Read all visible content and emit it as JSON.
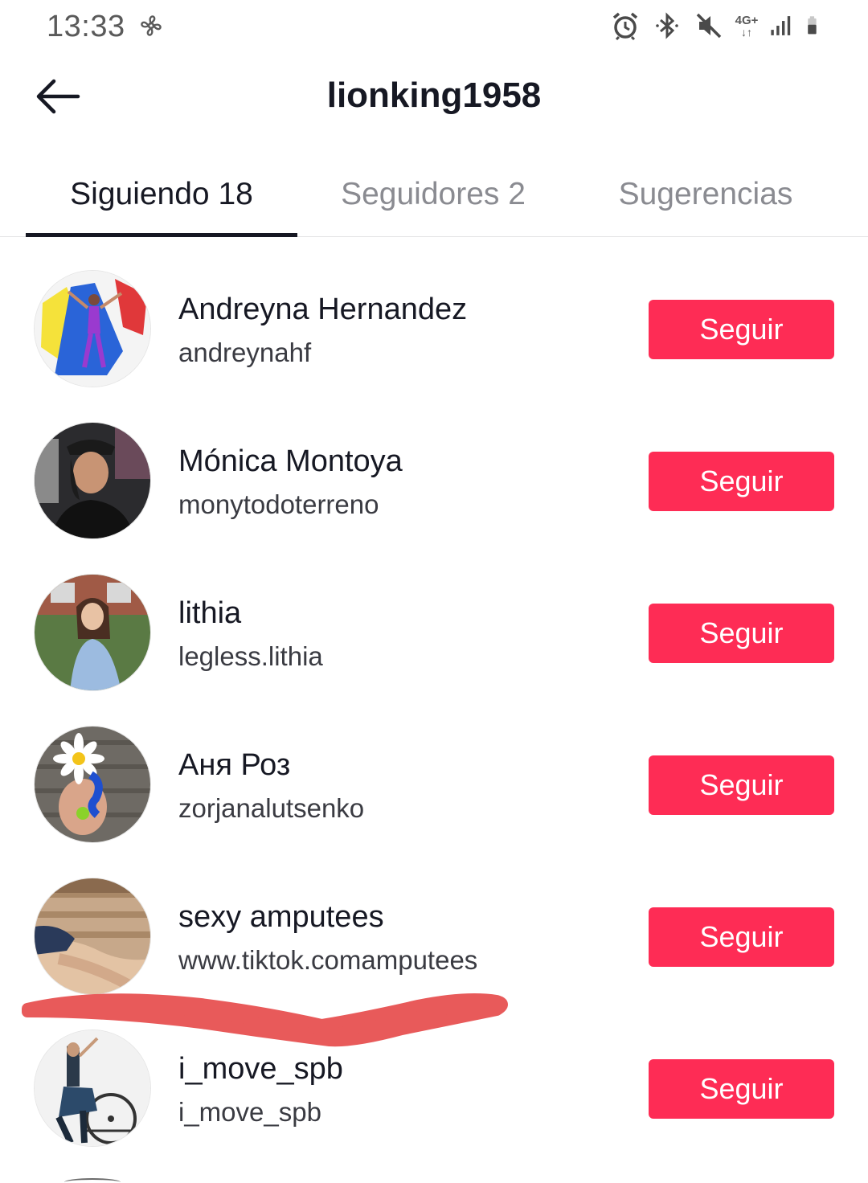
{
  "status_bar": {
    "time": "13:33",
    "left_icon": "fan-icon",
    "icons": [
      "alarm-icon",
      "bluetooth-icon",
      "mute-icon",
      "network-4g-icon",
      "signal-icon",
      "battery-icon"
    ],
    "network_label": "4G+"
  },
  "header": {
    "title": "lionking1958",
    "back_icon": "arrow-left-icon"
  },
  "tabs": [
    {
      "label": "Siguiendo 18",
      "active": true
    },
    {
      "label": "Seguidores 2",
      "active": false
    },
    {
      "label": "Sugerencias",
      "active": false
    }
  ],
  "users": [
    {
      "name": "Andreyna Hernandez",
      "handle": "andreynahf",
      "button": "Seguir"
    },
    {
      "name": "Mónica Montoya",
      "handle": "monytodoterreno",
      "button": "Seguir"
    },
    {
      "name": "lithia",
      "handle": "legless.lithia",
      "button": "Seguir"
    },
    {
      "name": "Аня  Роз",
      "handle": "zorjanalutsenko",
      "button": "Seguir"
    },
    {
      "name": "sexy amputees",
      "handle": "www.tiktok.comamputees",
      "button": "Seguir"
    },
    {
      "name": "i_move_spb",
      "handle": "i_move_spb",
      "button": "Seguir"
    }
  ],
  "colors": {
    "accent": "#fe2c55",
    "scribble": "#e85a5a",
    "text_primary": "#161823",
    "text_secondary": "#8a8b91"
  }
}
